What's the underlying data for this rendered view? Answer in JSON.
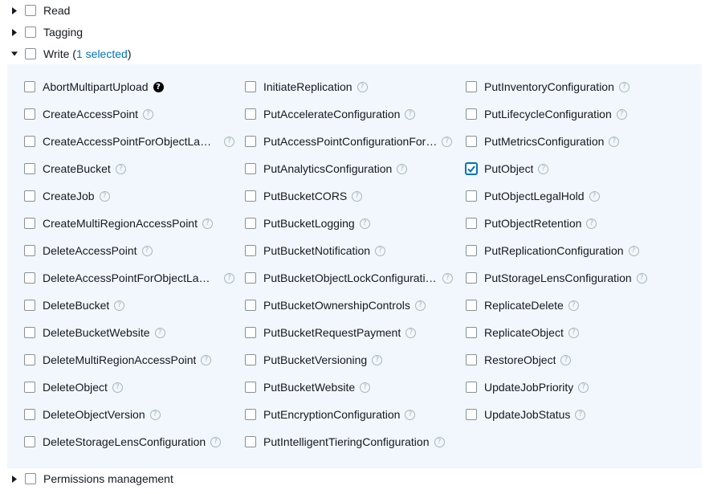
{
  "groups": {
    "read": {
      "label": "Read"
    },
    "tagging": {
      "label": "Tagging"
    },
    "write": {
      "label": "Write",
      "selection_open": " (",
      "selection_text": "1 selected",
      "selection_close": ")"
    },
    "permissions": {
      "label": "Permissions management"
    }
  },
  "help_glyph": "?",
  "colors": {
    "accent": "#0073bb",
    "panel_bg": "#f1f7fc"
  },
  "columns": [
    [
      {
        "label": "AbortMultipartUpload",
        "checked": false,
        "help_style": "solid"
      },
      {
        "label": "CreateAccessPoint",
        "checked": false
      },
      {
        "label": "CreateAccessPointForObjectLam…",
        "checked": false
      },
      {
        "label": "CreateBucket",
        "checked": false
      },
      {
        "label": "CreateJob",
        "checked": false
      },
      {
        "label": "CreateMultiRegionAccessPoint",
        "checked": false
      },
      {
        "label": "DeleteAccessPoint",
        "checked": false
      },
      {
        "label": "DeleteAccessPointForObjectLam…",
        "checked": false
      },
      {
        "label": "DeleteBucket",
        "checked": false
      },
      {
        "label": "DeleteBucketWebsite",
        "checked": false
      },
      {
        "label": "DeleteMultiRegionAccessPoint",
        "checked": false
      },
      {
        "label": "DeleteObject",
        "checked": false
      },
      {
        "label": "DeleteObjectVersion",
        "checked": false
      },
      {
        "label": "DeleteStorageLensConfiguration",
        "checked": false
      }
    ],
    [
      {
        "label": "InitiateReplication",
        "checked": false
      },
      {
        "label": "PutAccelerateConfiguration",
        "checked": false
      },
      {
        "label": "PutAccessPointConfigurationFor…",
        "checked": false
      },
      {
        "label": "PutAnalyticsConfiguration",
        "checked": false
      },
      {
        "label": "PutBucketCORS",
        "checked": false
      },
      {
        "label": "PutBucketLogging",
        "checked": false
      },
      {
        "label": "PutBucketNotification",
        "checked": false
      },
      {
        "label": "PutBucketObjectLockConfiguration",
        "checked": false
      },
      {
        "label": "PutBucketOwnershipControls",
        "checked": false
      },
      {
        "label": "PutBucketRequestPayment",
        "checked": false
      },
      {
        "label": "PutBucketVersioning",
        "checked": false
      },
      {
        "label": "PutBucketWebsite",
        "checked": false
      },
      {
        "label": "PutEncryptionConfiguration",
        "checked": false
      },
      {
        "label": "PutIntelligentTieringConfiguration",
        "checked": false
      }
    ],
    [
      {
        "label": "PutInventoryConfiguration",
        "checked": false
      },
      {
        "label": "PutLifecycleConfiguration",
        "checked": false
      },
      {
        "label": "PutMetricsConfiguration",
        "checked": false
      },
      {
        "label": "PutObject",
        "checked": true
      },
      {
        "label": "PutObjectLegalHold",
        "checked": false
      },
      {
        "label": "PutObjectRetention",
        "checked": false
      },
      {
        "label": "PutReplicationConfiguration",
        "checked": false
      },
      {
        "label": "PutStorageLensConfiguration",
        "checked": false
      },
      {
        "label": "ReplicateDelete",
        "checked": false
      },
      {
        "label": "ReplicateObject",
        "checked": false
      },
      {
        "label": "RestoreObject",
        "checked": false
      },
      {
        "label": "UpdateJobPriority",
        "checked": false
      },
      {
        "label": "UpdateJobStatus",
        "checked": false
      }
    ]
  ]
}
